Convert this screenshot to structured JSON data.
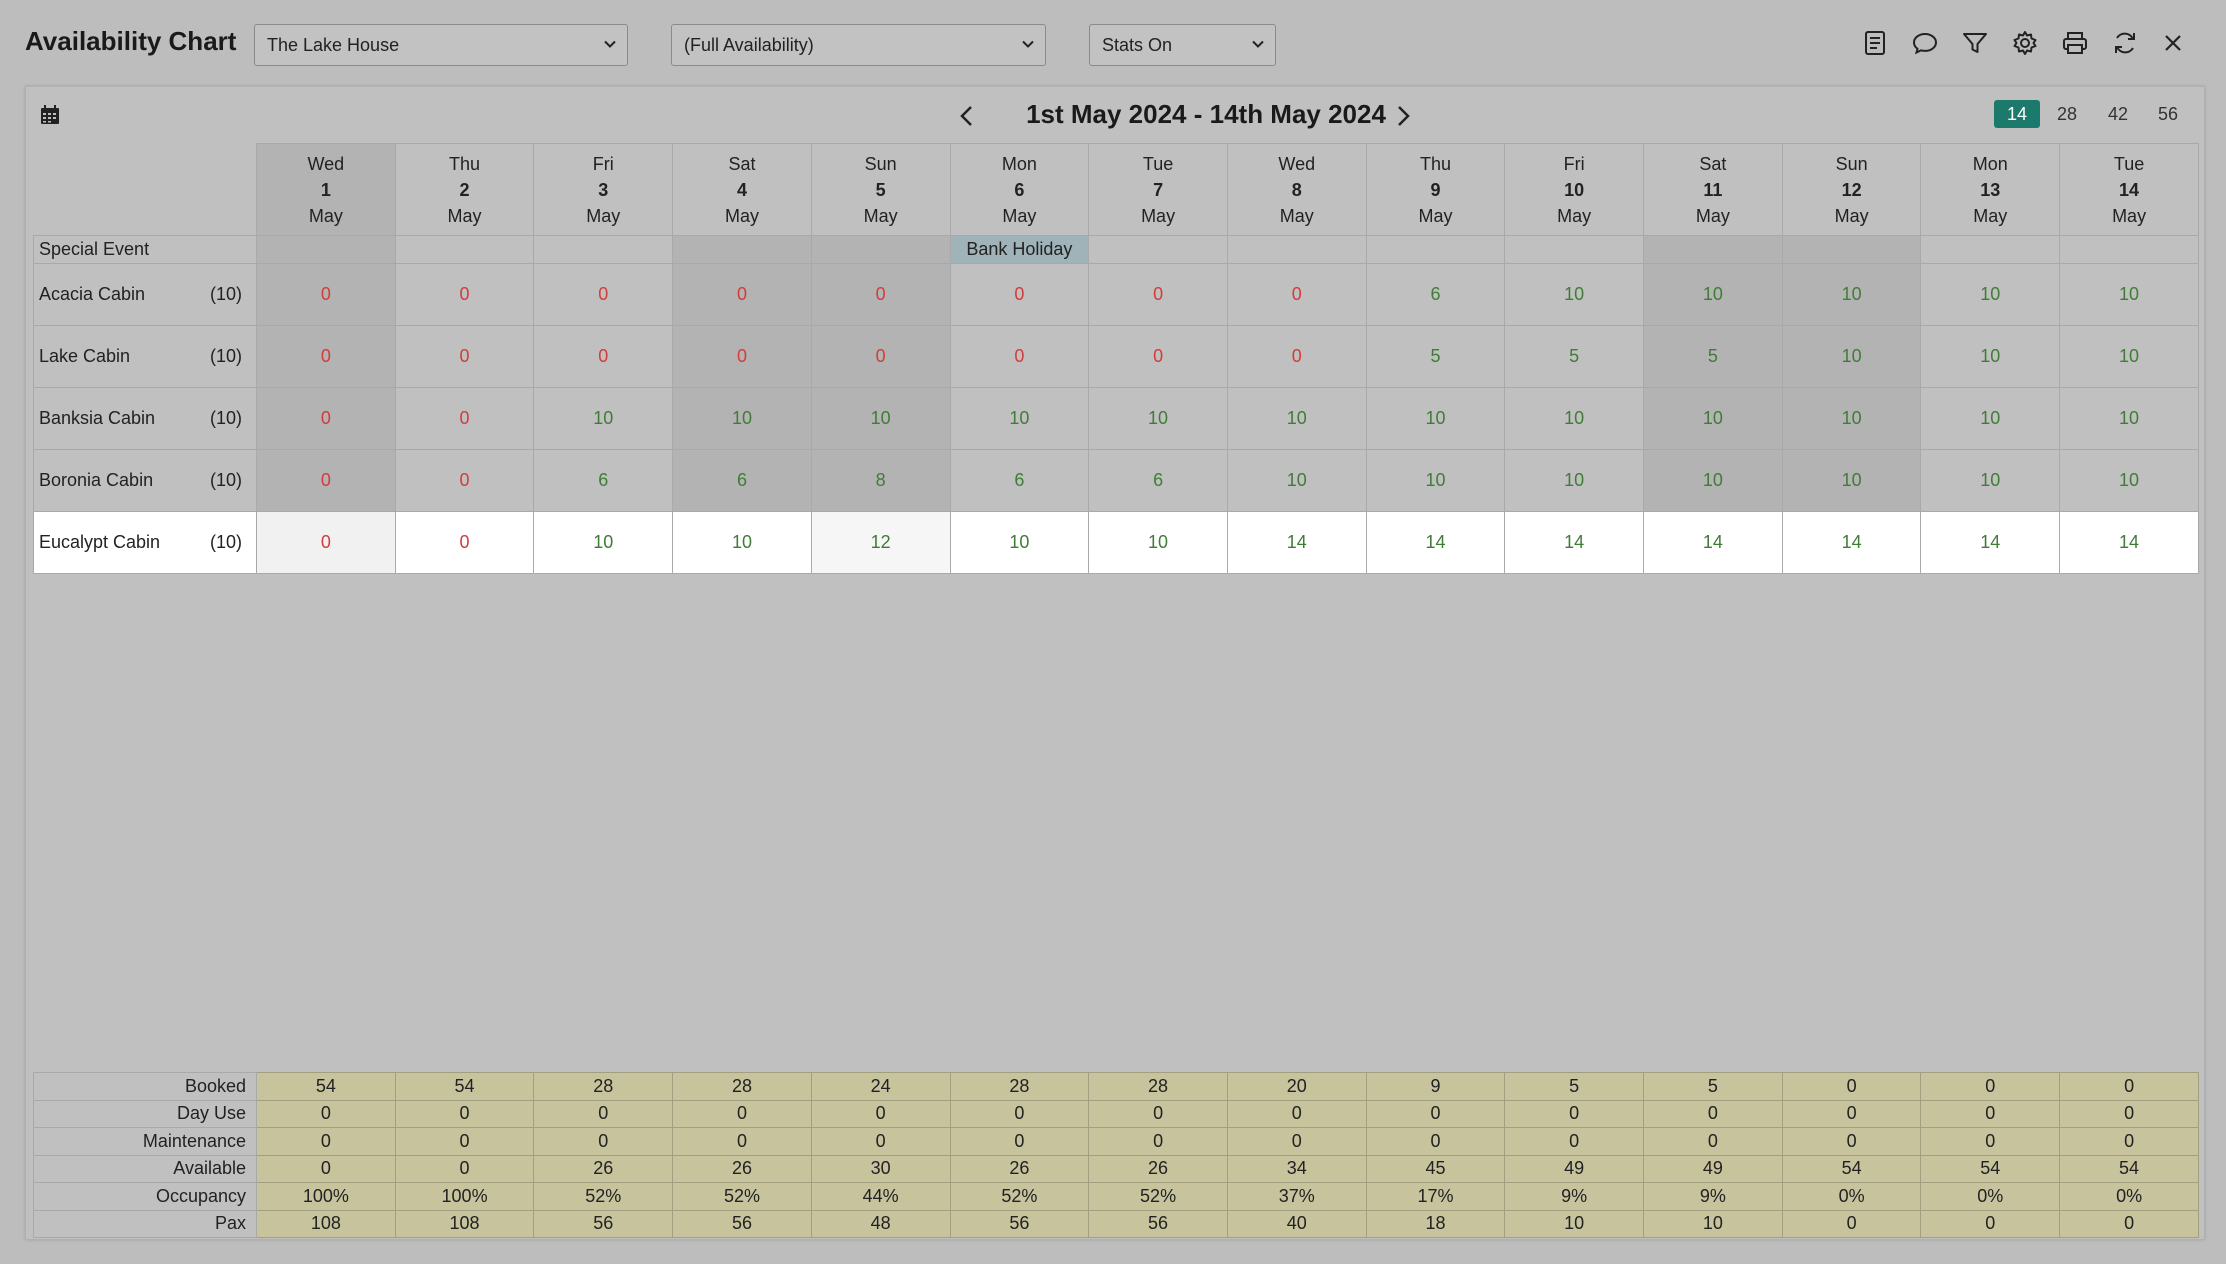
{
  "header": {
    "title": "Availability Chart",
    "property_select": "The Lake House",
    "mode_select": "(Full Availability)",
    "stats_select": "Stats On"
  },
  "toolbar": {
    "icons": [
      "list-icon",
      "comment-icon",
      "filter-icon",
      "gear-icon",
      "print-icon",
      "refresh-icon",
      "close-icon"
    ]
  },
  "panel": {
    "date_range": "1st May 2024 - 14th May 2024",
    "span_options": [
      "14",
      "28",
      "42",
      "56"
    ],
    "active_span": "14"
  },
  "days": [
    {
      "dow": "Wed",
      "num": "1",
      "mon": "May"
    },
    {
      "dow": "Thu",
      "num": "2",
      "mon": "May"
    },
    {
      "dow": "Fri",
      "num": "3",
      "mon": "May"
    },
    {
      "dow": "Sat",
      "num": "4",
      "mon": "May"
    },
    {
      "dow": "Sun",
      "num": "5",
      "mon": "May"
    },
    {
      "dow": "Mon",
      "num": "6",
      "mon": "May"
    },
    {
      "dow": "Tue",
      "num": "7",
      "mon": "May"
    },
    {
      "dow": "Wed",
      "num": "8",
      "mon": "May"
    },
    {
      "dow": "Thu",
      "num": "9",
      "mon": "May"
    },
    {
      "dow": "Fri",
      "num": "10",
      "mon": "May"
    },
    {
      "dow": "Sat",
      "num": "11",
      "mon": "May"
    },
    {
      "dow": "Sun",
      "num": "12",
      "mon": "May"
    },
    {
      "dow": "Mon",
      "num": "13",
      "mon": "May"
    },
    {
      "dow": "Tue",
      "num": "14",
      "mon": "May"
    }
  ],
  "special_event": {
    "label": "Special Event",
    "cells": [
      "",
      "",
      "",
      "",
      "",
      "Bank Holiday",
      "",
      "",
      "",
      "",
      "",
      "",
      "",
      ""
    ]
  },
  "rooms": [
    {
      "name": "Acacia Cabin",
      "capacity": "(10)",
      "values": [
        "0",
        "0",
        "0",
        "0",
        "0",
        "0",
        "0",
        "0",
        "6",
        "10",
        "10",
        "10",
        "10",
        "10"
      ]
    },
    {
      "name": "Lake Cabin",
      "capacity": "(10)",
      "values": [
        "0",
        "0",
        "0",
        "0",
        "0",
        "0",
        "0",
        "0",
        "5",
        "5",
        "5",
        "10",
        "10",
        "10"
      ]
    },
    {
      "name": "Banksia Cabin",
      "capacity": "(10)",
      "values": [
        "0",
        "0",
        "10",
        "10",
        "10",
        "10",
        "10",
        "10",
        "10",
        "10",
        "10",
        "10",
        "10",
        "10"
      ]
    },
    {
      "name": "Boronia Cabin",
      "capacity": "(10)",
      "values": [
        "0",
        "0",
        "6",
        "6",
        "8",
        "6",
        "6",
        "10",
        "10",
        "10",
        "10",
        "10",
        "10",
        "10"
      ]
    },
    {
      "name": "Eucalypt Cabin",
      "capacity": "(10)",
      "values": [
        "0",
        "0",
        "10",
        "10",
        "12",
        "10",
        "10",
        "14",
        "14",
        "14",
        "14",
        "14",
        "14",
        "14"
      ]
    }
  ],
  "stats": [
    {
      "label": "Booked",
      "values": [
        "54",
        "54",
        "28",
        "28",
        "24",
        "28",
        "28",
        "20",
        "9",
        "5",
        "5",
        "0",
        "0",
        "0"
      ]
    },
    {
      "label": "Day Use",
      "values": [
        "0",
        "0",
        "0",
        "0",
        "0",
        "0",
        "0",
        "0",
        "0",
        "0",
        "0",
        "0",
        "0",
        "0"
      ]
    },
    {
      "label": "Maintenance",
      "values": [
        "0",
        "0",
        "0",
        "0",
        "0",
        "0",
        "0",
        "0",
        "0",
        "0",
        "0",
        "0",
        "0",
        "0"
      ]
    },
    {
      "label": "Available",
      "values": [
        "0",
        "0",
        "26",
        "26",
        "30",
        "26",
        "26",
        "34",
        "45",
        "49",
        "49",
        "54",
        "54",
        "54"
      ]
    },
    {
      "label": "Occupancy",
      "values": [
        "100%",
        "100%",
        "52%",
        "52%",
        "44%",
        "52%",
        "52%",
        "37%",
        "17%",
        "9%",
        "9%",
        "0%",
        "0%",
        "0%"
      ]
    },
    {
      "label": "Pax",
      "values": [
        "108",
        "108",
        "56",
        "56",
        "48",
        "56",
        "56",
        "40",
        "18",
        "10",
        "10",
        "0",
        "0",
        "0"
      ]
    }
  ],
  "colors": {
    "zero": "#d43b3b",
    "available": "#3f7d36",
    "accent": "#1b7a6c",
    "holiday": "#9fb3b8",
    "stats_bg": "#c6c39d"
  }
}
